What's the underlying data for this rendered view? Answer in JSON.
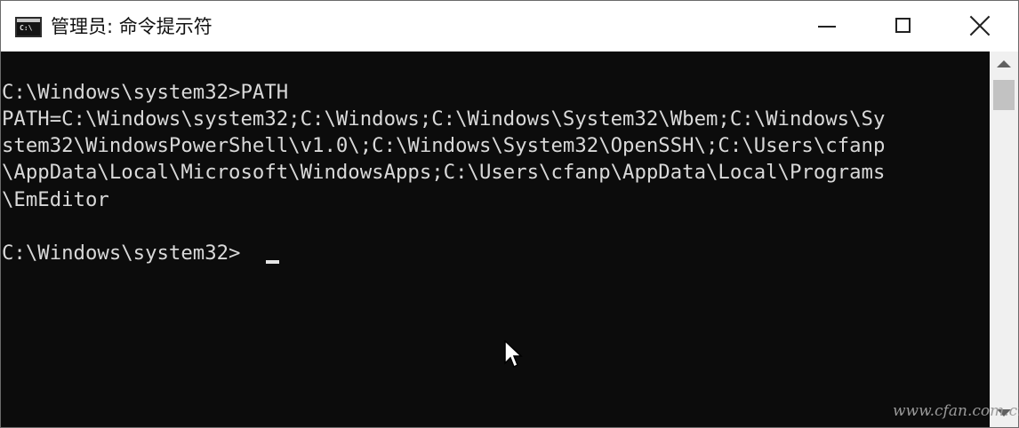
{
  "window": {
    "title": "管理员: 命令提示符",
    "icon_glyph": "C:\\",
    "controls": {
      "minimize_icon": "minimize-icon",
      "maximize_icon": "maximize-icon",
      "close_icon": "close-icon"
    }
  },
  "console": {
    "lines": [
      "C:\\Windows\\system32>PATH",
      "PATH=C:\\Windows\\system32;C:\\Windows;C:\\Windows\\System32\\Wbem;C:\\Windows\\Sy",
      "stem32\\WindowsPowerShell\\v1.0\\;C:\\Windows\\System32\\OpenSSH\\;C:\\Users\\cfanp",
      "\\AppData\\Local\\Microsoft\\WindowsApps;C:\\Users\\cfanp\\AppData\\Local\\Programs",
      "\\EmEditor",
      "",
      "C:\\Windows\\system32>"
    ],
    "text_color": "#d9d9d9",
    "background": "#0c0c0c"
  },
  "watermark": "www.cfan.com.cn"
}
